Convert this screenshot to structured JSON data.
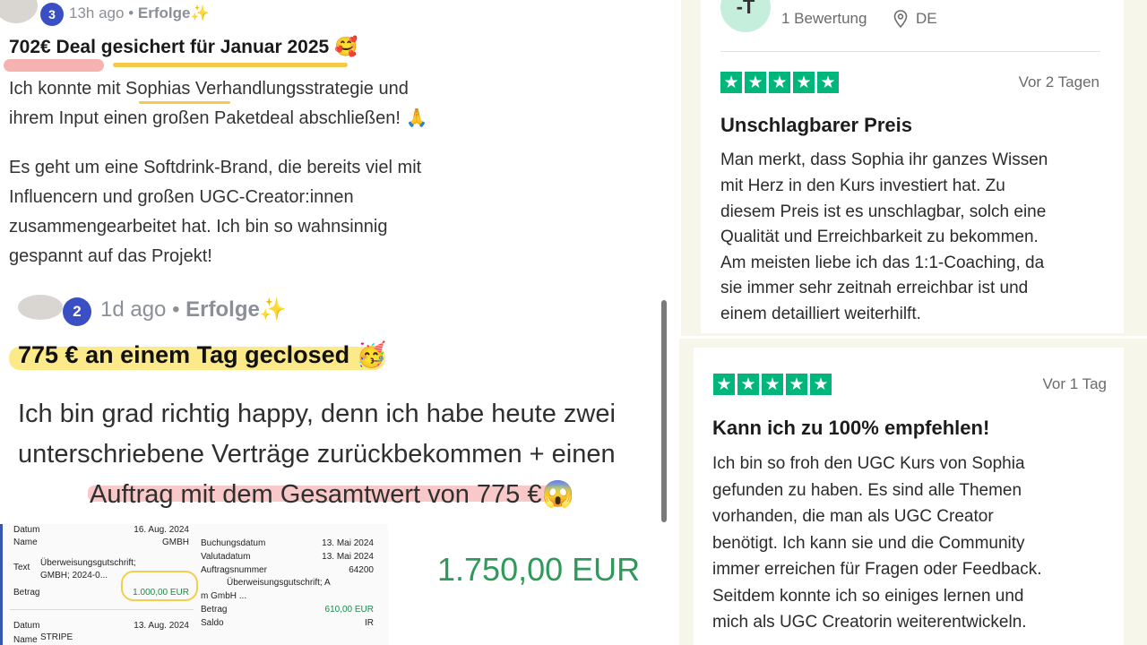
{
  "post1": {
    "badge": "3",
    "time": "13h ago",
    "sep": "•",
    "category": "Erfolge",
    "sparkle": "✨",
    "title": "702€ Deal gesichert für Januar 2025",
    "title_emoji": "🥰",
    "body": [
      "Ich konnte mit Sophias Verhandlungsstrategie und",
      "ihrem Input einen großen Paketdeal abschließen! 🙏",
      "Es geht um eine Softdrink-Brand, die bereits viel mit",
      "Influencern und großen UGC-Creator:innen",
      "zusammengearbeitet hat. Ich bin so wahnsinnig",
      "gespannt auf das Projekt!"
    ]
  },
  "post2": {
    "badge": "2",
    "time": "1d ago",
    "sep": "•",
    "category": "Erfolge",
    "sparkle": "✨",
    "title": "775 € an einem Tag geclosed",
    "title_emoji": "🥳",
    "body": [
      "Ich bin grad richtig happy, denn ich habe heute zwei",
      "unterschriebene Verträge zurückbekommen + einen",
      "Auftrag mit dem Gesamtwert von 775 €😱"
    ]
  },
  "bank_left": {
    "rows": [
      {
        "label": "Datum",
        "value": "16. Aug. 2024"
      },
      {
        "label": "Name",
        "value": "GMBH"
      },
      {
        "label": "Text",
        "value": "Überweisungsgutschrift;"
      },
      {
        "label": "",
        "value": "GMBH; 2024-0..."
      },
      {
        "label": "Betrag",
        "value": "1.000,00 EUR"
      },
      {
        "label": "Datum",
        "value": "13. Aug. 2024"
      },
      {
        "label": "Name",
        "value": "STRIPE"
      }
    ]
  },
  "bank_right": {
    "rows": [
      {
        "label": "Buchungsdatum",
        "value": "13. Mai 2024"
      },
      {
        "label": "Valutadatum",
        "value": "13. Mai 2024"
      },
      {
        "label": "Auftragsnummer",
        "value": "64200"
      },
      {
        "label": "",
        "value": "Überweisungsgutschrift; A"
      },
      {
        "label": "Text",
        "value": "m GmbH ..."
      },
      {
        "label": "Betrag",
        "value": "610,00 EUR"
      },
      {
        "label": "Saldo",
        "value": "IR"
      }
    ]
  },
  "amount_big": "1.750,00 EUR",
  "review1": {
    "avatar_initials": "-T",
    "rating_count": "1 Bewertung",
    "country": "DE",
    "stars": 5,
    "date": "Vor 2 Tagen",
    "title": "Unschlagbarer Preis",
    "body": [
      "Man merkt, dass Sophia ihr ganzes Wissen",
      "mit Herz in den Kurs investiert hat. Zu",
      "diesem Preis ist es unschlagbar, solch eine",
      "Qualität und Erreichbarkeit zu bekommen.",
      "Am meisten liebe ich das 1:1-Coaching, da",
      "sie immer sehr zeitnah erreichbar ist und",
      "einem detailliert weiterhilft."
    ]
  },
  "review2": {
    "stars": 5,
    "date": "Vor 1 Tag",
    "title": "Kann ich zu 100% empfehlen!",
    "body": [
      "Ich bin so froh den UGC Kurs von Sophia",
      "gefunden zu haben. Es sind alle Themen",
      "vorhanden, die man als UGC Creator",
      "benötigt. Ich kann sie und die Community",
      "immer erreichen für Fragen oder Feedback.",
      "Seitdem konnte ich so einiges lernen und",
      "mich als UGC Creatorin weiterentwickeln."
    ]
  },
  "colors": {
    "trustpilot_green": "#00b67a",
    "badge_blue": "#3b4fc4",
    "amount_green": "#2e9a5a",
    "highlight_yellow": "#fbe46b",
    "highlight_red": "#f5a3a3"
  },
  "icons": {
    "star": "star-icon",
    "location": "location-pin-icon"
  }
}
